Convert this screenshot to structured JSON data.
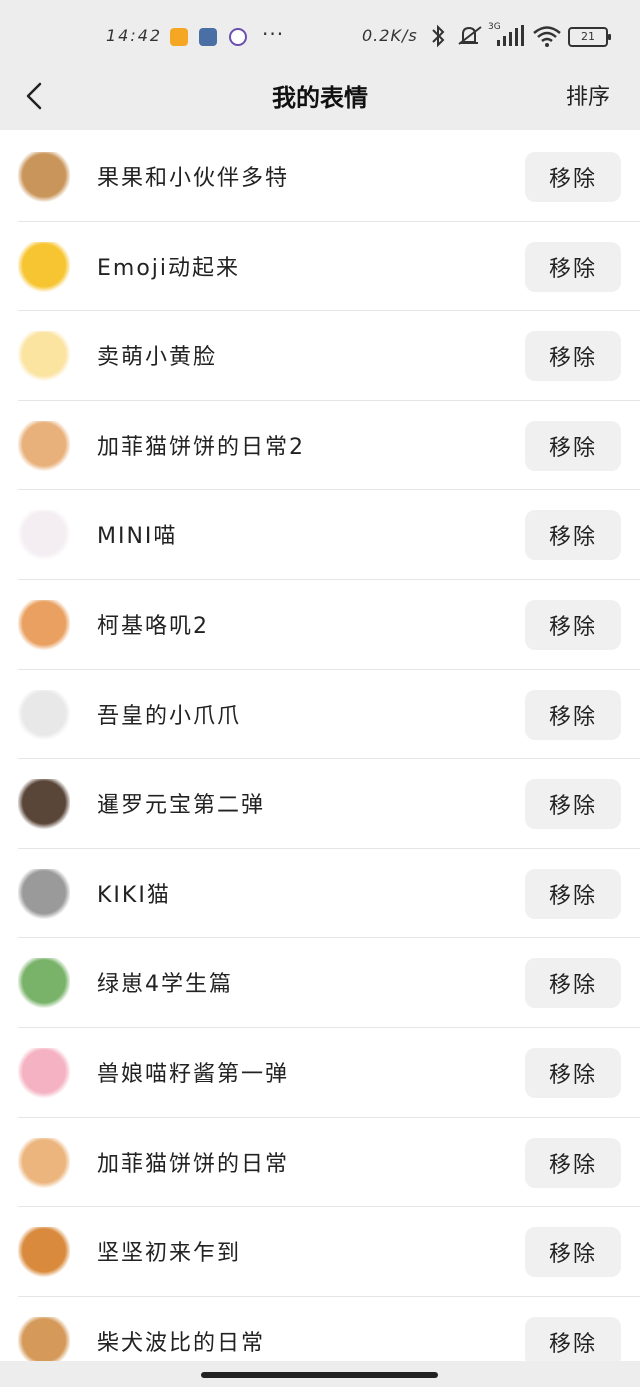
{
  "status_bar": {
    "time": "14:42",
    "more": "···",
    "net_speed": "0.2K/s",
    "network_type": "3G",
    "battery": "21",
    "icons": [
      "app-orange-icon",
      "settings-app-icon",
      "camera-app-icon",
      "bluetooth-icon",
      "mute-icon",
      "signal-icon",
      "wifi-icon",
      "battery-icon"
    ]
  },
  "header": {
    "back_icon": "chevron-left-icon",
    "title": "我的表情",
    "sort_label": "排序"
  },
  "list": {
    "remove_label": "移除",
    "items": [
      {
        "name": "果果和小伙伴多特",
        "thumb": "orange-cat",
        "color": "#c9955a"
      },
      {
        "name": "Emoji动起来",
        "thumb": "sunglasses-emoji",
        "color": "#f7c531"
      },
      {
        "name": "卖萌小黄脸",
        "thumb": "blush-face",
        "color": "#fbe3a0"
      },
      {
        "name": "加菲猫饼饼的日常2",
        "thumb": "garfield-cat",
        "color": "#e8b07a"
      },
      {
        "name": "MINI喵",
        "thumb": "white-cat",
        "color": "#f4eef2"
      },
      {
        "name": "柯基咯叽2",
        "thumb": "corgi",
        "color": "#e9a060"
      },
      {
        "name": "吾皇的小爪爪",
        "thumb": "paw",
        "color": "#e8e8e8"
      },
      {
        "name": "暹罗元宝第二弹",
        "thumb": "siamese-cat",
        "color": "#5a4638"
      },
      {
        "name": "KIKI猫",
        "thumb": "tabby-cat",
        "color": "#9a9a9a"
      },
      {
        "name": "绿崽4学生篇",
        "thumb": "green-graduate",
        "color": "#79b36a"
      },
      {
        "name": "兽娘喵籽酱第一弹",
        "thumb": "anime-girl",
        "color": "#f5b2c2"
      },
      {
        "name": "加菲猫饼饼的日常",
        "thumb": "garfield-cat-2",
        "color": "#ecb57d"
      },
      {
        "name": "坚坚初来乍到",
        "thumb": "ginger-cat",
        "color": "#d98a3c"
      },
      {
        "name": "柴犬波比的日常",
        "thumb": "shiba-dog",
        "color": "#d59a5a"
      }
    ]
  }
}
